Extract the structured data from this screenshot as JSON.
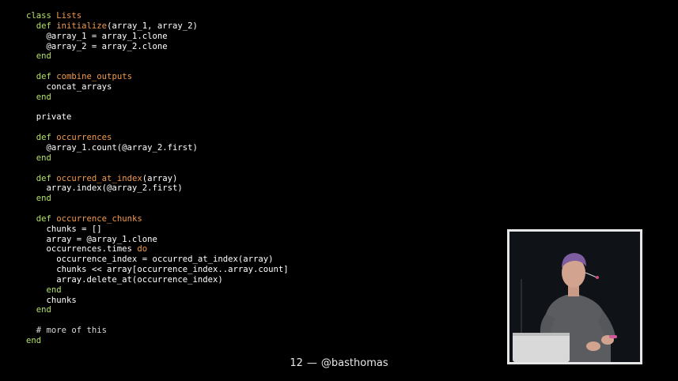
{
  "code_lines": [
    [
      {
        "t": "class ",
        "c": "kw"
      },
      {
        "t": "Lists",
        "c": "name"
      }
    ],
    [
      {
        "t": "  def ",
        "c": "kw"
      },
      {
        "t": "initialize",
        "c": "name"
      },
      {
        "t": "(array_1, array_2)",
        "c": "txt"
      }
    ],
    [
      {
        "t": "    @array_1 = array_1.clone",
        "c": "txt"
      }
    ],
    [
      {
        "t": "    @array_2 = array_2.clone",
        "c": "txt"
      }
    ],
    [
      {
        "t": "  end",
        "c": "kw"
      }
    ],
    [],
    [
      {
        "t": "  def ",
        "c": "kw"
      },
      {
        "t": "combine_outputs",
        "c": "name"
      }
    ],
    [
      {
        "t": "    concat_arrays",
        "c": "txt"
      }
    ],
    [
      {
        "t": "  end",
        "c": "kw"
      }
    ],
    [],
    [
      {
        "t": "  private",
        "c": "txt"
      }
    ],
    [],
    [
      {
        "t": "  def ",
        "c": "kw"
      },
      {
        "t": "occurrences",
        "c": "name"
      }
    ],
    [
      {
        "t": "    @array_1.count(@array_2.first)",
        "c": "txt"
      }
    ],
    [
      {
        "t": "  end",
        "c": "kw"
      }
    ],
    [],
    [
      {
        "t": "  def ",
        "c": "kw"
      },
      {
        "t": "occurred_at_index",
        "c": "name"
      },
      {
        "t": "(array)",
        "c": "txt"
      }
    ],
    [
      {
        "t": "    array.index(@array_2.first)",
        "c": "txt"
      }
    ],
    [
      {
        "t": "  end",
        "c": "kw"
      }
    ],
    [],
    [
      {
        "t": "  def ",
        "c": "kw"
      },
      {
        "t": "occurrence_chunks",
        "c": "name"
      }
    ],
    [
      {
        "t": "    chunks = []",
        "c": "txt"
      }
    ],
    [
      {
        "t": "    array = @array_1.clone",
        "c": "txt"
      }
    ],
    [
      {
        "t": "    occurrences.times ",
        "c": "txt"
      },
      {
        "t": "do",
        "c": "name"
      }
    ],
    [
      {
        "t": "      occurrence_index = occurred_at_index(array)",
        "c": "txt"
      }
    ],
    [
      {
        "t": "      chunks << array[occurrence_index..array.count]",
        "c": "txt"
      }
    ],
    [
      {
        "t": "      array.delete_at(occurrence_index)",
        "c": "txt"
      }
    ],
    [
      {
        "t": "    end",
        "c": "kw"
      }
    ],
    [
      {
        "t": "    chunks",
        "c": "txt"
      }
    ],
    [
      {
        "t": "  end",
        "c": "kw"
      }
    ],
    [],
    [
      {
        "t": "  # more of this",
        "c": "comment"
      }
    ],
    [
      {
        "t": "end",
        "c": "kw"
      }
    ]
  ],
  "footer": {
    "page_number": "12",
    "separator": "—",
    "handle": "@basthomas"
  },
  "colors": {
    "background": "#000000",
    "keyword": "#b4e06a",
    "method_name": "#f29a4b",
    "text": "#ffffff"
  },
  "video_overlay": {
    "icon": "speaker-video"
  }
}
